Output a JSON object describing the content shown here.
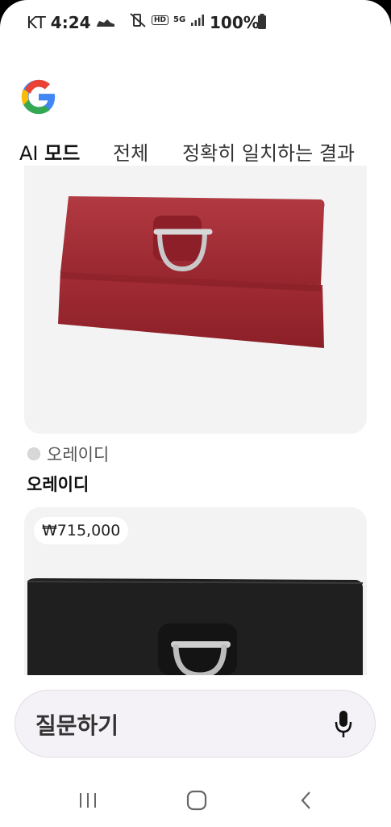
{
  "status_bar": {
    "carrier": "KT",
    "time": "4:24",
    "battery": "100%",
    "icons": [
      "shoe-icon",
      "mute-vibrate-icon",
      "hd-icon",
      "5g-icon",
      "signal-icon",
      "battery-icon"
    ],
    "network_label": "5G",
    "hd_label": "HD"
  },
  "header": {
    "logo": "google-g-icon",
    "tabs": [
      {
        "prefix": "AI ",
        "label": "모드"
      },
      {
        "label": "전체"
      },
      {
        "label": "정확히 일치하는 결과"
      }
    ]
  },
  "results": [
    {
      "image": "red-leather-wallet",
      "source": "오레이디",
      "title": "오레이디"
    },
    {
      "image": "black-leather-wallet",
      "price": "₩715,000"
    }
  ],
  "search": {
    "placeholder": "질문하기",
    "mic_icon": "microphone-icon"
  },
  "nav": [
    "recents-icon",
    "home-icon",
    "back-icon"
  ],
  "colors": {
    "accent": "#1a73e8",
    "wallet_red": "#a52a32",
    "wallet_black": "#1e1e1e"
  }
}
